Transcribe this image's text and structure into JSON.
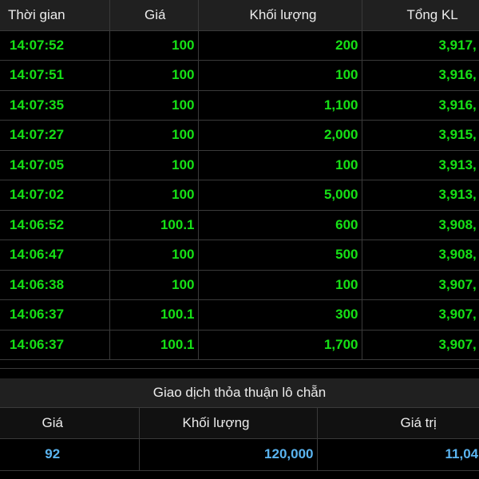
{
  "trades": {
    "columns": {
      "time": "Thời gian",
      "price": "Giá",
      "volume": "Khối lượng",
      "total_volume": "Tổng KL"
    },
    "rows": [
      {
        "time": "14:07:52",
        "price": "100",
        "volume": "200",
        "total_volume": "3,917,"
      },
      {
        "time": "14:07:51",
        "price": "100",
        "volume": "100",
        "total_volume": "3,916,"
      },
      {
        "time": "14:07:35",
        "price": "100",
        "volume": "1,100",
        "total_volume": "3,916,"
      },
      {
        "time": "14:07:27",
        "price": "100",
        "volume": "2,000",
        "total_volume": "3,915,"
      },
      {
        "time": "14:07:05",
        "price": "100",
        "volume": "100",
        "total_volume": "3,913,"
      },
      {
        "time": "14:07:02",
        "price": "100",
        "volume": "5,000",
        "total_volume": "3,913,"
      },
      {
        "time": "14:06:52",
        "price": "100.1",
        "volume": "600",
        "total_volume": "3,908,"
      },
      {
        "time": "14:06:47",
        "price": "100",
        "volume": "500",
        "total_volume": "3,908,"
      },
      {
        "time": "14:06:38",
        "price": "100",
        "volume": "100",
        "total_volume": "3,907,"
      },
      {
        "time": "14:06:37",
        "price": "100.1",
        "volume": "300",
        "total_volume": "3,907,"
      },
      {
        "time": "14:06:37",
        "price": "100.1",
        "volume": "1,700",
        "total_volume": "3,907,"
      }
    ]
  },
  "put_through": {
    "title": "Giao dịch thỏa thuận lô chẵn",
    "columns": {
      "price": "Giá",
      "volume": "Khối lượng",
      "value": "Giá trị"
    },
    "rows": [
      {
        "price": "92",
        "volume": "120,000",
        "value": "11,04"
      }
    ]
  },
  "colors": {
    "background": "#000000",
    "header_bg": "#202020",
    "trade_text": "#16e016",
    "put_through_text": "#5ab4f0",
    "grid_line": "#3a3a3a"
  }
}
